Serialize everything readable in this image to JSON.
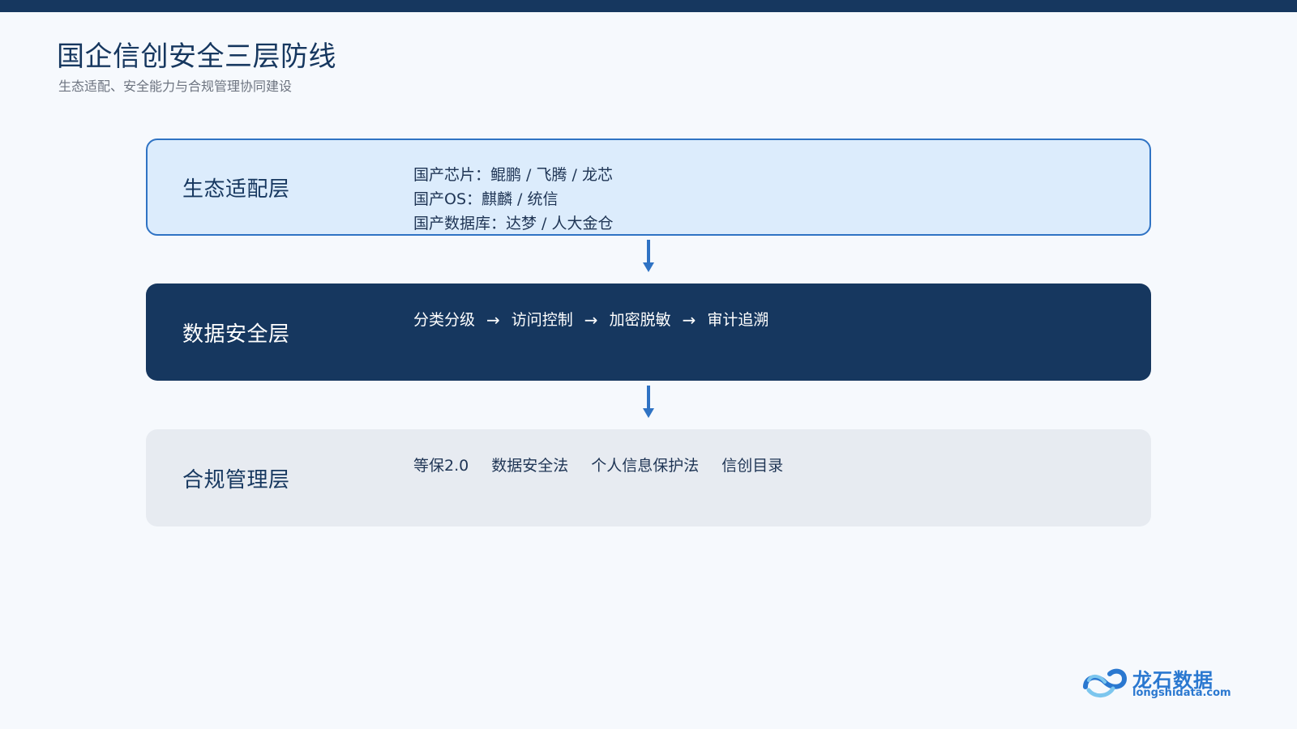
{
  "header": {
    "title": "国企信创安全三层防线",
    "subtitle": "生态适配、安全能力与合规管理协同建设"
  },
  "layers": [
    {
      "name": "生态适配层",
      "items": [
        "国产芯片：鲲鹏 / 飞腾 / 龙芯",
        "国产OS：麒麟 / 统信",
        "国产数据库：达梦 / 人大金仓"
      ]
    },
    {
      "name": "数据安全层",
      "flow": [
        "分类分级",
        "访问控制",
        "加密脱敏",
        "审计追溯"
      ],
      "arrow": "→"
    },
    {
      "name": "合规管理层",
      "items": [
        "等保2.0",
        "数据安全法",
        "个人信息保护法",
        "信创目录"
      ]
    }
  ],
  "logo": {
    "name_cn": "龙石数据",
    "domain": "longshidata.com"
  },
  "colors": {
    "navy": "#16375f",
    "accent_blue": "#2f73c4",
    "light_blue": "#dcecfc",
    "light_gray": "#e7ebf1",
    "background": "#f6f9fd"
  }
}
